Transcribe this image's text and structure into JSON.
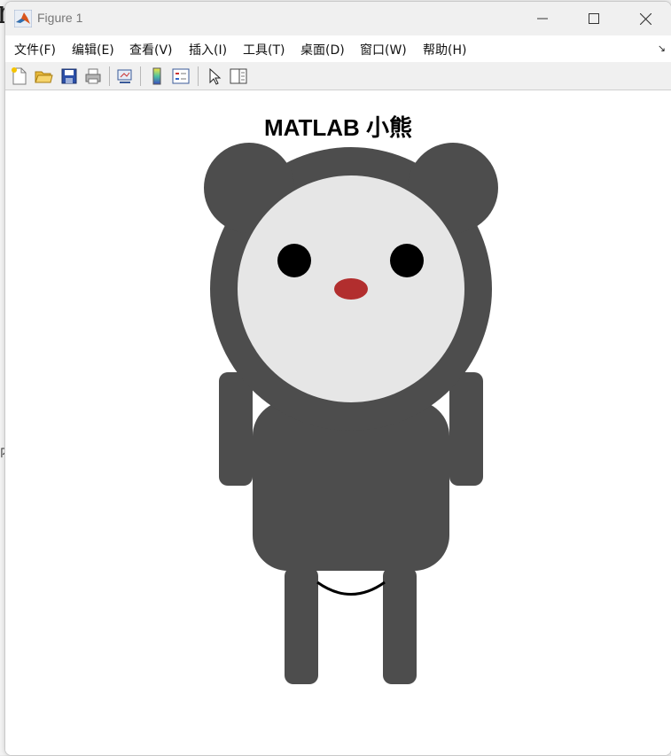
{
  "window": {
    "title": "Figure 1"
  },
  "menu": {
    "items": [
      "文件(F)",
      "编辑(E)",
      "查看(V)",
      "插入(I)",
      "工具(T)",
      "桌面(D)",
      "窗口(W)",
      "帮助(H)"
    ],
    "dock_arrow": "↘"
  },
  "toolbar": {
    "icons": [
      "new-figure-icon",
      "open-file-icon",
      "save-icon",
      "print-icon",
      "link-plot-icon",
      "colorbar-icon",
      "legend-icon",
      "pointer-icon",
      "property-inspector-icon"
    ]
  },
  "figure": {
    "title": "MATLAB 小熊",
    "colors": {
      "fur": "#4d4d4d",
      "face": "#e6e6e6",
      "eyes": "#000000",
      "nose": "#b22e2e",
      "smile": "#000000"
    }
  },
  "background": {
    "side_glyph": "内"
  }
}
